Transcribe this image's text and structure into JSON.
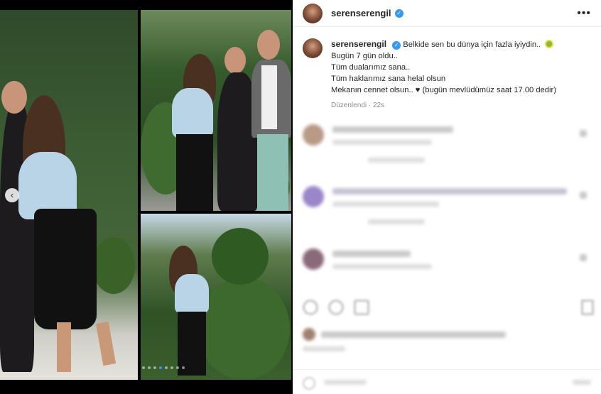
{
  "post": {
    "username": "serenserengil",
    "verified_mark": "✓",
    "more_label": "•••",
    "caption_lines": [
      "Belkide sen bu dünya için fazla iyiydin..",
      "Bugün 7 gün oldu..",
      "Tüm dualarımız sana..",
      "Tüm haklarımız sana helal olsun",
      "Mekanın cennet olsun.. ♥ (bugün mevlüdümüz saat 17.00 dedir)"
    ],
    "edited_label": "Düzenlendi",
    "time_ago": "22s"
  },
  "carousel": {
    "prev_label": "‹"
  },
  "icons": {
    "more": "more-options-icon",
    "verified": "verified-badge-icon",
    "heart": "heart-icon",
    "like": "like-icon",
    "comment": "comment-icon",
    "share": "share-icon",
    "save": "bookmark-icon"
  },
  "colors": {
    "verified": "#3897f0",
    "text": "#262626",
    "meta": "#8e8e8e"
  }
}
